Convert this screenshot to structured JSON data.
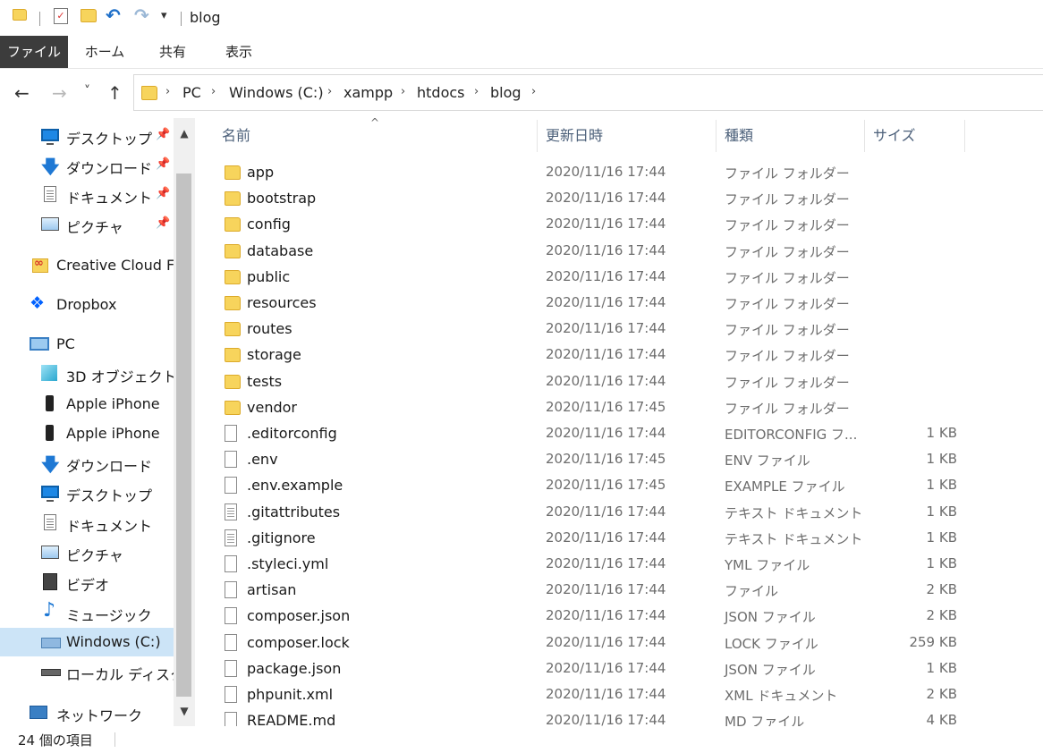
{
  "window": {
    "title": "blog"
  },
  "ribbon": {
    "tabs": [
      {
        "label": "ファイル"
      },
      {
        "label": "ホーム"
      },
      {
        "label": "共有"
      },
      {
        "label": "表示"
      }
    ]
  },
  "navigation": {
    "back": "←",
    "forward": "→",
    "recent": "˅",
    "up": "↑"
  },
  "address": {
    "crumbs": [
      "PC",
      "Windows (C:)",
      "xampp",
      "htdocs",
      "blog"
    ]
  },
  "nav_pane": {
    "items": [
      {
        "label": "デスクトップ",
        "icon": "desktop-icon",
        "pinned": true
      },
      {
        "label": "ダウンロード",
        "icon": "download-icon",
        "pinned": true
      },
      {
        "label": "ドキュメント",
        "icon": "document-icon",
        "pinned": true
      },
      {
        "label": "ピクチャ",
        "icon": "pictures-icon",
        "pinned": true
      },
      {
        "label": "Creative Cloud Files",
        "icon": "creative-cloud-icon"
      },
      {
        "label": "Dropbox",
        "icon": "dropbox-icon"
      },
      {
        "label": "PC",
        "icon": "pc-icon"
      },
      {
        "label": "3D オブジェクト",
        "icon": "3d-objects-icon"
      },
      {
        "label": "Apple iPhone",
        "icon": "phone-icon"
      },
      {
        "label": "Apple iPhone",
        "icon": "phone-icon"
      },
      {
        "label": "ダウンロード",
        "icon": "download-icon"
      },
      {
        "label": "デスクトップ",
        "icon": "desktop-icon"
      },
      {
        "label": "ドキュメント",
        "icon": "document-icon"
      },
      {
        "label": "ピクチャ",
        "icon": "pictures-icon"
      },
      {
        "label": "ビデオ",
        "icon": "video-icon"
      },
      {
        "label": "ミュージック",
        "icon": "music-icon"
      },
      {
        "label": "Windows (C:)",
        "icon": "drive-icon",
        "selected": true
      },
      {
        "label": "ローカル ディスク (D:)",
        "icon": "local-disk-icon"
      },
      {
        "label": "ネットワーク",
        "icon": "network-icon"
      }
    ]
  },
  "columns": {
    "name": "名前",
    "date": "更新日時",
    "type": "種類",
    "size": "サイズ"
  },
  "files": [
    {
      "name": "app",
      "date": "2020/11/16 17:44",
      "type": "ファイル フォルダー",
      "size": "",
      "kind": "folder"
    },
    {
      "name": "bootstrap",
      "date": "2020/11/16 17:44",
      "type": "ファイル フォルダー",
      "size": "",
      "kind": "folder"
    },
    {
      "name": "config",
      "date": "2020/11/16 17:44",
      "type": "ファイル フォルダー",
      "size": "",
      "kind": "folder"
    },
    {
      "name": "database",
      "date": "2020/11/16 17:44",
      "type": "ファイル フォルダー",
      "size": "",
      "kind": "folder"
    },
    {
      "name": "public",
      "date": "2020/11/16 17:44",
      "type": "ファイル フォルダー",
      "size": "",
      "kind": "folder"
    },
    {
      "name": "resources",
      "date": "2020/11/16 17:44",
      "type": "ファイル フォルダー",
      "size": "",
      "kind": "folder"
    },
    {
      "name": "routes",
      "date": "2020/11/16 17:44",
      "type": "ファイル フォルダー",
      "size": "",
      "kind": "folder"
    },
    {
      "name": "storage",
      "date": "2020/11/16 17:44",
      "type": "ファイル フォルダー",
      "size": "",
      "kind": "folder"
    },
    {
      "name": "tests",
      "date": "2020/11/16 17:44",
      "type": "ファイル フォルダー",
      "size": "",
      "kind": "folder"
    },
    {
      "name": "vendor",
      "date": "2020/11/16 17:45",
      "type": "ファイル フォルダー",
      "size": "",
      "kind": "folder"
    },
    {
      "name": ".editorconfig",
      "date": "2020/11/16 17:44",
      "type": "EDITORCONFIG フ...",
      "size": "1 KB",
      "kind": "file"
    },
    {
      "name": ".env",
      "date": "2020/11/16 17:45",
      "type": "ENV ファイル",
      "size": "1 KB",
      "kind": "file"
    },
    {
      "name": ".env.example",
      "date": "2020/11/16 17:45",
      "type": "EXAMPLE ファイル",
      "size": "1 KB",
      "kind": "file"
    },
    {
      "name": ".gitattributes",
      "date": "2020/11/16 17:44",
      "type": "テキスト ドキュメント",
      "size": "1 KB",
      "kind": "text"
    },
    {
      "name": ".gitignore",
      "date": "2020/11/16 17:44",
      "type": "テキスト ドキュメント",
      "size": "1 KB",
      "kind": "text"
    },
    {
      "name": ".styleci.yml",
      "date": "2020/11/16 17:44",
      "type": "YML ファイル",
      "size": "1 KB",
      "kind": "file"
    },
    {
      "name": "artisan",
      "date": "2020/11/16 17:44",
      "type": "ファイル",
      "size": "2 KB",
      "kind": "file"
    },
    {
      "name": "composer.json",
      "date": "2020/11/16 17:44",
      "type": "JSON ファイル",
      "size": "2 KB",
      "kind": "file"
    },
    {
      "name": "composer.lock",
      "date": "2020/11/16 17:44",
      "type": "LOCK ファイル",
      "size": "259 KB",
      "kind": "file"
    },
    {
      "name": "package.json",
      "date": "2020/11/16 17:44",
      "type": "JSON ファイル",
      "size": "1 KB",
      "kind": "file"
    },
    {
      "name": "phpunit.xml",
      "date": "2020/11/16 17:44",
      "type": "XML ドキュメント",
      "size": "2 KB",
      "kind": "file"
    },
    {
      "name": "README.md",
      "date": "2020/11/16 17:44",
      "type": "MD ファイル",
      "size": "4 KB",
      "kind": "file"
    }
  ],
  "status": {
    "item_count": "24 個の項目"
  },
  "colors": {
    "accent": "#cce4f7",
    "file_tab": "#3c3c3c",
    "folder": "#f7d45c"
  }
}
